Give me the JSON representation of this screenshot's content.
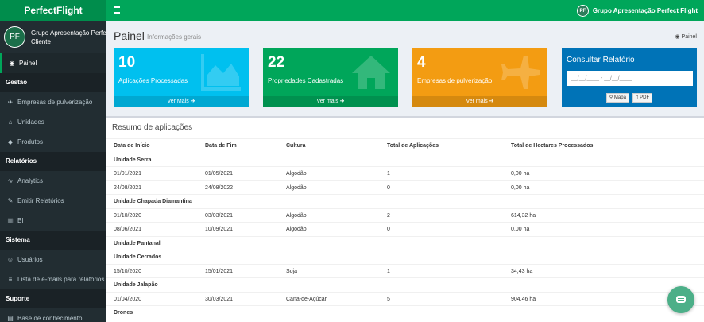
{
  "app": {
    "logo": "PerfectFlight",
    "top_user": "Grupo Apresentação Perfect Flight",
    "avatar_text": "PF"
  },
  "sidebar": {
    "user_name": "Grupo Apresentação Perfect Flight",
    "user_role": "Cliente",
    "items": [
      {
        "type": "item",
        "label": "Painel",
        "icon": "dashboard-icon",
        "glyph": "◉",
        "active": true
      },
      {
        "type": "header",
        "label": "Gestão"
      },
      {
        "type": "item",
        "label": "Empresas de pulverização",
        "icon": "plane-icon",
        "glyph": "✈"
      },
      {
        "type": "item",
        "label": "Unidades",
        "icon": "home-icon",
        "glyph": "⌂"
      },
      {
        "type": "item",
        "label": "Produtos",
        "icon": "tag-icon",
        "glyph": "◆"
      },
      {
        "type": "header",
        "label": "Relatórios"
      },
      {
        "type": "item",
        "label": "Analytics",
        "icon": "chart-line-icon",
        "glyph": "∿"
      },
      {
        "type": "item",
        "label": "Emitir Relatórios",
        "icon": "edit-icon",
        "glyph": "✎"
      },
      {
        "type": "item",
        "label": "BI",
        "icon": "bar-chart-icon",
        "glyph": "▥"
      },
      {
        "type": "header",
        "label": "Sistema"
      },
      {
        "type": "item",
        "label": "Usuários",
        "icon": "users-icon",
        "glyph": "☺"
      },
      {
        "type": "item",
        "label": "Lista de e-mails para relatórios",
        "icon": "list-icon",
        "glyph": "≡"
      },
      {
        "type": "header",
        "label": "Suporte"
      },
      {
        "type": "item",
        "label": "Base de conhecimento",
        "icon": "book-icon",
        "glyph": "▤"
      }
    ]
  },
  "page": {
    "title": "Painel",
    "subtitle": "Informações gerais",
    "breadcrumb": "Painel"
  },
  "boxes": [
    {
      "number": "10",
      "label": "Aplicações Processadas",
      "footer": "Ver Mais ➔"
    },
    {
      "number": "22",
      "label": "Propriedades Cadastradas",
      "footer": "Ver mais ➔"
    },
    {
      "number": "4",
      "label": "Empresas de pulverização",
      "footer": "Ver mais ➔"
    }
  ],
  "report": {
    "title": "Consultar Relatório",
    "date_placeholder": "__/__/____ - __/__/____",
    "map_button": "Mapa",
    "pdf_button": "PDF"
  },
  "summary": {
    "title": "Resumo de aplicações",
    "columns": [
      "Data de Início",
      "Data de Fim",
      "Cultura",
      "Total de Aplicações",
      "Total de Hectares Processados"
    ],
    "rows": [
      {
        "group": "Unidade Serra"
      },
      {
        "cells": [
          "01/01/2021",
          "01/05/2021",
          "Algodão",
          "1",
          "0,00 ha"
        ]
      },
      {
        "cells": [
          "24/08/2021",
          "24/08/2022",
          "Algodão",
          "0",
          "0,00 ha"
        ]
      },
      {
        "group": "Unidade Chapada Diamantina"
      },
      {
        "cells": [
          "01/10/2020",
          "03/03/2021",
          "Algodão",
          "2",
          "614,32 ha"
        ]
      },
      {
        "cells": [
          "08/06/2021",
          "10/09/2021",
          "Algodão",
          "0",
          "0,00 ha"
        ]
      },
      {
        "group": "Unidade Pantanal"
      },
      {
        "group": "Unidade Cerrados"
      },
      {
        "cells": [
          "15/10/2020",
          "15/01/2021",
          "Soja",
          "1",
          "34,43 ha"
        ]
      },
      {
        "group": "Unidade Jalapão"
      },
      {
        "cells": [
          "01/04/2020",
          "30/03/2021",
          "Cana-de-Açúcar",
          "5",
          "904,46 ha"
        ]
      },
      {
        "group": "Drones"
      }
    ]
  }
}
